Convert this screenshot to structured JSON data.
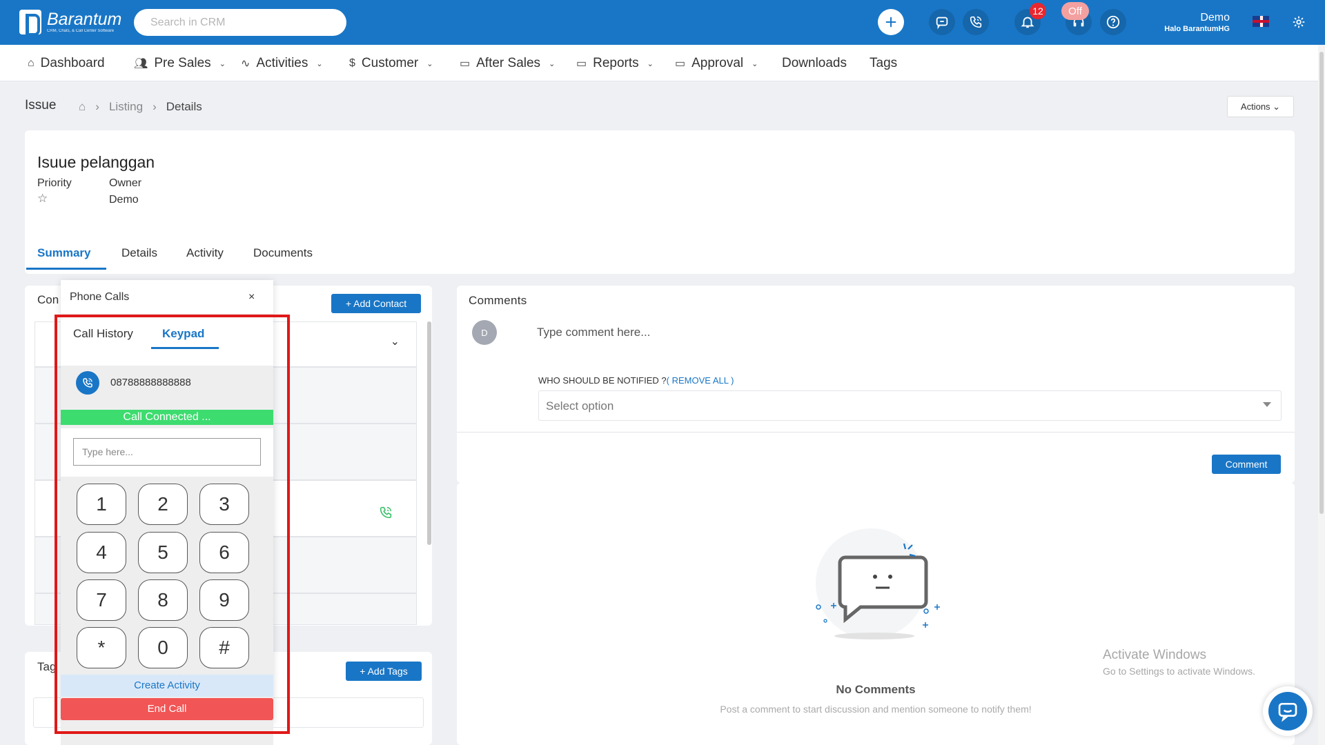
{
  "brand": {
    "name": "Barantum",
    "tagline": "CRM, Chats, & Call Center Software"
  },
  "search": {
    "placeholder": "Search in CRM"
  },
  "topbar": {
    "notification_count": "12",
    "status": "Off",
    "user_name": "Demo",
    "user_subtitle": "Halo BarantumHG"
  },
  "nav": [
    {
      "label": "Dashboard",
      "icon": "home-icon"
    },
    {
      "label": "Pre Sales",
      "icon": "users-icon"
    },
    {
      "label": "Activities",
      "icon": "pulse-icon"
    },
    {
      "label": "Customer",
      "icon": "dollar-icon"
    },
    {
      "label": "After Sales",
      "icon": "folder-icon"
    },
    {
      "label": "Reports",
      "icon": "folder-icon"
    },
    {
      "label": "Approval",
      "icon": "folder-icon"
    },
    {
      "label": "Downloads"
    },
    {
      "label": "Tags"
    }
  ],
  "breadcrumb": {
    "heading": "Issue",
    "listing": "Listing",
    "current": "Details",
    "actions": "Actions ⌄"
  },
  "issue": {
    "title": "Isuue pelanggan",
    "priority_label": "Priority",
    "owner_label": "Owner",
    "owner_value": "Demo"
  },
  "tabs": [
    "Summary",
    "Details",
    "Activity",
    "Documents"
  ],
  "contacts": {
    "title": "Con",
    "add_button": "+ Add Contact"
  },
  "tags": {
    "title": "Tag",
    "add_button": "+ Add Tags"
  },
  "comments": {
    "title": "Comments",
    "avatar": "D",
    "input_placeholder": "Type comment here...",
    "notify_label": "WHO SHOULD BE NOTIFIED ?",
    "remove_all": "( REMOVE ALL )",
    "select_placeholder": "Select option",
    "comment_button": "Comment",
    "empty_title": "No Comments",
    "empty_subtitle": "Post a comment to start discussion and mention someone to notify them!"
  },
  "phone": {
    "title": "Phone Calls",
    "close": "×",
    "tab_history": "Call History",
    "tab_keypad": "Keypad",
    "number": "08788888888888",
    "status": "Call Connected ...",
    "input_placeholder": "Type here...",
    "keys": [
      "1",
      "2",
      "3",
      "4",
      "5",
      "6",
      "7",
      "8",
      "9",
      "*",
      "0",
      "#"
    ],
    "create_activity": "Create Activity",
    "end_call": "End Call"
  },
  "watermark": {
    "line1": "Activate Windows",
    "line2": "Go to Settings to activate Windows."
  }
}
